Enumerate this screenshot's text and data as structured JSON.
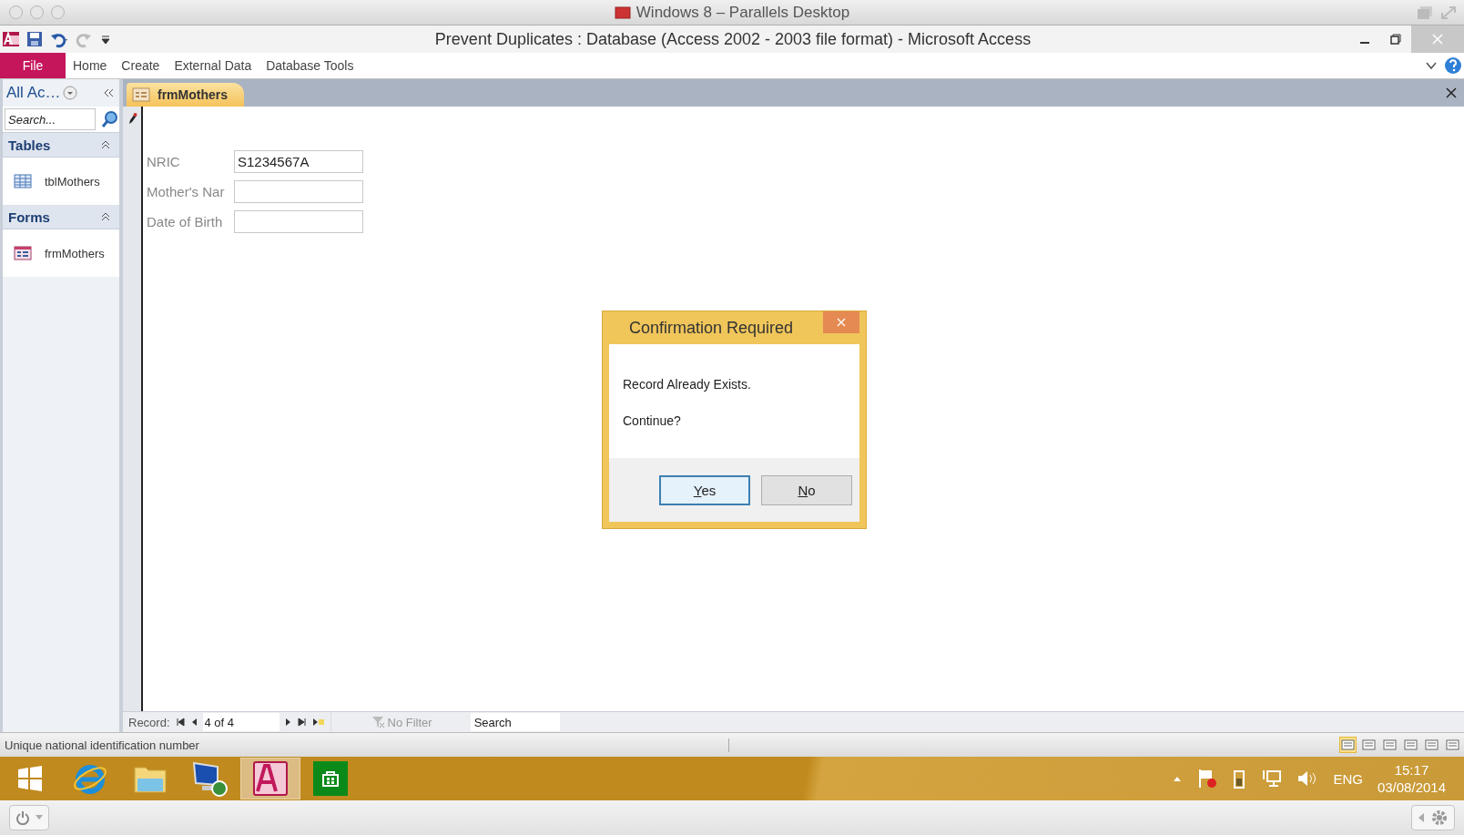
{
  "host_window": {
    "title": "Windows 8 – Parallels Desktop"
  },
  "window": {
    "title": "Prevent Duplicates : Database (Access 2002 - 2003 file format) - Microsoft Access"
  },
  "ribbon": {
    "tabs": [
      {
        "label": "File",
        "kind": "file"
      },
      {
        "label": "Home",
        "kind": "tab"
      },
      {
        "label": "Create",
        "kind": "tab"
      },
      {
        "label": "External Data",
        "kind": "tab"
      },
      {
        "label": "Database Tools",
        "kind": "tab"
      }
    ]
  },
  "nav_pane": {
    "title": "All Ac…",
    "search": {
      "placeholder": "Search..."
    },
    "groups": [
      {
        "label": "Tables",
        "expanded": true,
        "items": [
          {
            "label": "tblMothers",
            "kind": "table"
          }
        ]
      },
      {
        "label": "Forms",
        "expanded": true,
        "items": [
          {
            "label": "frmMothers",
            "kind": "form"
          }
        ]
      }
    ]
  },
  "document_tabs": [
    {
      "label": "frmMothers",
      "selected": true
    }
  ],
  "form": {
    "fields": [
      {
        "label": "NRIC",
        "value": "S1234567A"
      },
      {
        "label": "Mother's Nar"
      },
      {
        "label": "Date of Birth"
      }
    ]
  },
  "dialog": {
    "title": "Confirmation Required",
    "message": [
      "Record Already Exists.",
      "Continue?"
    ],
    "buttons": [
      {
        "label": "Yes",
        "selected": true
      },
      {
        "label": "No",
        "selected": false
      }
    ]
  },
  "record_nav": {
    "label": "Record:",
    "position": "4 of 4",
    "filter": "No Filter",
    "search": {
      "placeholder": "Search"
    }
  },
  "status_bar": {
    "text": "Unique national identification number"
  },
  "taskbar": {
    "apps": [
      {
        "kind": "browser",
        "selected": false
      },
      {
        "kind": "folder",
        "selected": false
      },
      {
        "kind": "remote",
        "selected": false
      },
      {
        "kind": "access",
        "selected": true
      },
      {
        "kind": "store",
        "selected": false
      }
    ]
  },
  "tray": {
    "language": "ENG",
    "time": "15:17",
    "date": "03/08/2014"
  }
}
